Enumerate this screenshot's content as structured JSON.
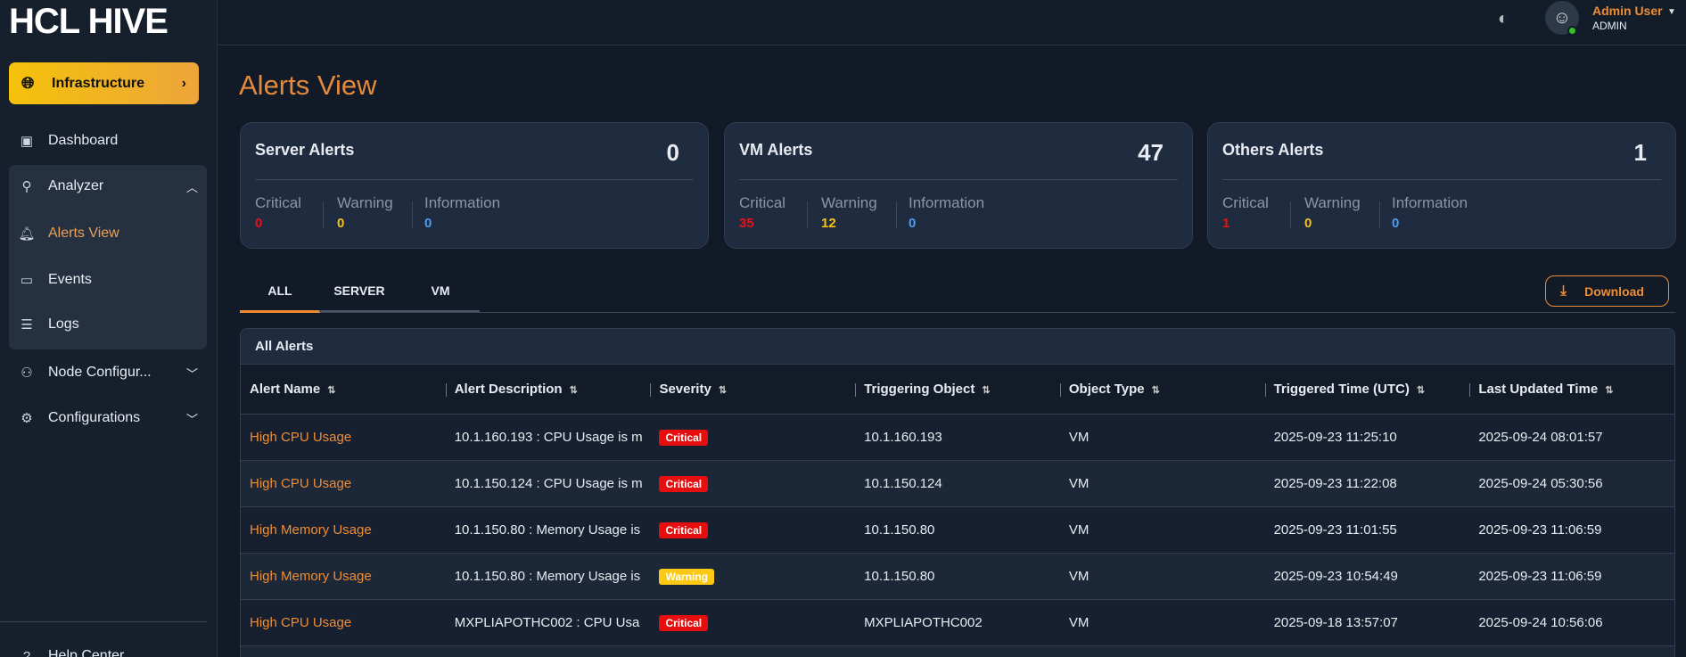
{
  "sidebar": {
    "logo": "HCL HIVE",
    "infra": "Infrastructure",
    "items": [
      {
        "label": "Dashboard"
      },
      {
        "label": "Analyzer"
      },
      {
        "label": "Alerts View"
      },
      {
        "label": "Events"
      },
      {
        "label": "Logs"
      },
      {
        "label": "Node Configur..."
      },
      {
        "label": "Configurations"
      },
      {
        "label": "Help Center"
      }
    ]
  },
  "header": {
    "user": "Admin User",
    "role": "ADMIN"
  },
  "page": {
    "title": "Alerts View"
  },
  "cards": [
    {
      "title": "Server Alerts",
      "total": "0",
      "critical": "0",
      "warning": "0",
      "information": "0"
    },
    {
      "title": "VM Alerts",
      "total": "47",
      "critical": "35",
      "warning": "12",
      "information": "0"
    },
    {
      "title": "Others Alerts",
      "total": "1",
      "critical": "1",
      "warning": "0",
      "information": "0"
    }
  ],
  "labels": {
    "critical": "Critical",
    "warning": "Warning",
    "information": "Information"
  },
  "tabs": [
    "ALL",
    "SERVER",
    "VM"
  ],
  "download": "Download",
  "table": {
    "title": "All Alerts",
    "columns": [
      "Alert Name",
      "Alert Description",
      "Severity",
      "Triggering Object",
      "Object Type",
      "Triggered Time (UTC)",
      "Last Updated Time"
    ],
    "rows": [
      [
        "High CPU Usage",
        "10.1.160.193 : CPU Usage is m",
        "Critical",
        "10.1.160.193",
        "VM",
        "2025-09-23 11:25:10",
        "2025-09-24 08:01:57"
      ],
      [
        "High CPU Usage",
        "10.1.150.124 : CPU Usage is m",
        "Critical",
        "10.1.150.124",
        "VM",
        "2025-09-23 11:22:08",
        "2025-09-24 05:30:56"
      ],
      [
        "High Memory Usage",
        "10.1.150.80 : Memory Usage is",
        "Critical",
        "10.1.150.80",
        "VM",
        "2025-09-23 11:01:55",
        "2025-09-23 11:06:59"
      ],
      [
        "High Memory Usage",
        "10.1.150.80 : Memory Usage is",
        "Warning",
        "10.1.150.80",
        "VM",
        "2025-09-23 10:54:49",
        "2025-09-23 11:06:59"
      ],
      [
        "High CPU Usage",
        "MXPLIAPOTHC002 : CPU Usa",
        "Critical",
        "MXPLIAPOTHC002",
        "VM",
        "2025-09-18 13:57:07",
        "2025-09-24 10:56:06"
      ]
    ]
  }
}
